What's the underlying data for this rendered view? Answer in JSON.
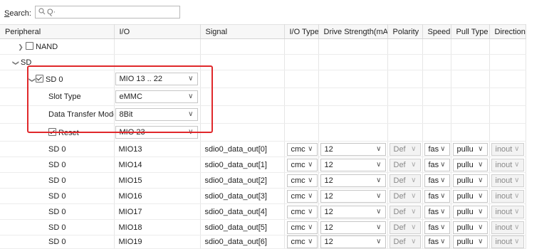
{
  "search": {
    "label_prefix": "S",
    "label_rest": "earch:",
    "placeholder": "Q·",
    "icon": "magnifier-icon"
  },
  "columns": [
    "Peripheral",
    "I/O",
    "Signal",
    "I/O Type",
    "Drive Strength(mA)",
    "Polarity",
    "Speed",
    "Pull Type",
    "Direction"
  ],
  "tree": {
    "nand": {
      "label": "NAND",
      "expanded": false,
      "checked": false
    },
    "sd": {
      "label": "SD",
      "expanded": true
    },
    "sd0": {
      "label": "SD 0",
      "checked": true,
      "io": "MIO 13 .. 22"
    },
    "slot_type": {
      "label": "Slot Type",
      "value": "eMMC"
    },
    "data_transfer": {
      "label": "Data Transfer Mode",
      "value": "8Bit"
    },
    "reset": {
      "label": "Reset",
      "checked": true,
      "value": "MIO 23"
    }
  },
  "rows": [
    {
      "peripheral": "SD 0",
      "io": "MIO13",
      "signal": "sdio0_data_out[0]",
      "io_type": "cmc",
      "drive": "12",
      "polarity": "Def",
      "speed": "fas",
      "pull": "pullu",
      "direction": "inout"
    },
    {
      "peripheral": "SD 0",
      "io": "MIO14",
      "signal": "sdio0_data_out[1]",
      "io_type": "cmc",
      "drive": "12",
      "polarity": "Def",
      "speed": "fas",
      "pull": "pullu",
      "direction": "inout"
    },
    {
      "peripheral": "SD 0",
      "io": "MIO15",
      "signal": "sdio0_data_out[2]",
      "io_type": "cmc",
      "drive": "12",
      "polarity": "Def",
      "speed": "fas",
      "pull": "pullu",
      "direction": "inout"
    },
    {
      "peripheral": "SD 0",
      "io": "MIO16",
      "signal": "sdio0_data_out[3]",
      "io_type": "cmc",
      "drive": "12",
      "polarity": "Def",
      "speed": "fas",
      "pull": "pullu",
      "direction": "inout"
    },
    {
      "peripheral": "SD 0",
      "io": "MIO17",
      "signal": "sdio0_data_out[4]",
      "io_type": "cmc",
      "drive": "12",
      "polarity": "Def",
      "speed": "fas",
      "pull": "pullu",
      "direction": "inout"
    },
    {
      "peripheral": "SD 0",
      "io": "MIO18",
      "signal": "sdio0_data_out[5]",
      "io_type": "cmc",
      "drive": "12",
      "polarity": "Def",
      "speed": "fas",
      "pull": "pullu",
      "direction": "inout"
    },
    {
      "peripheral": "SD 0",
      "io": "MIO19",
      "signal": "sdio0_data_out[6]",
      "io_type": "cmc",
      "drive": "12",
      "polarity": "Def",
      "speed": "fas",
      "pull": "pullu",
      "direction": "inout"
    }
  ],
  "colors": {
    "highlight": "#e0282b",
    "header_bg": "#f7f7f7",
    "grid_line": "#e6e6e6"
  }
}
